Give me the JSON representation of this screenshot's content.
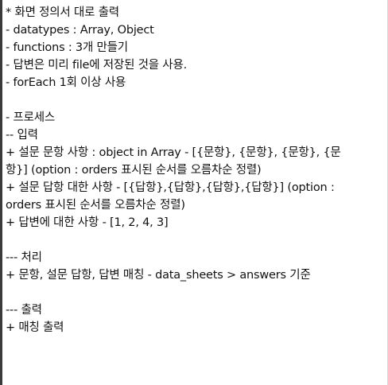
{
  "document": {
    "lines": [
      "* 화면 정의서 대로 출력",
      "- datatypes : Array, Object",
      "- functions : 3개 만들기",
      "- 답변은 미리 file에 저장된 것을 사용.",
      "- forEach 1회 이상 사용",
      "",
      "- 프로세스",
      "-- 입력",
      "+ 설문 문항 사항 : object in Array - [{문항}, {문항}, {문항}, {문",
      "항}] (option : orders 표시된 순서를 오름차순 정렬)",
      "+ 설문 답항 대한 사항 - [{답항},{답항},{답항},{답항}] (option :",
      "orders 표시된 순서를 오름차순 정렬)",
      "+ 답변에 대한 사항 - [1, 2, 4, 3]",
      "",
      "--- 처리",
      "+ 문항, 설문 답항, 답변 매칭 - data_sheets > answers 기준",
      "",
      "--- 출력",
      "+ 매칭 출력"
    ]
  }
}
